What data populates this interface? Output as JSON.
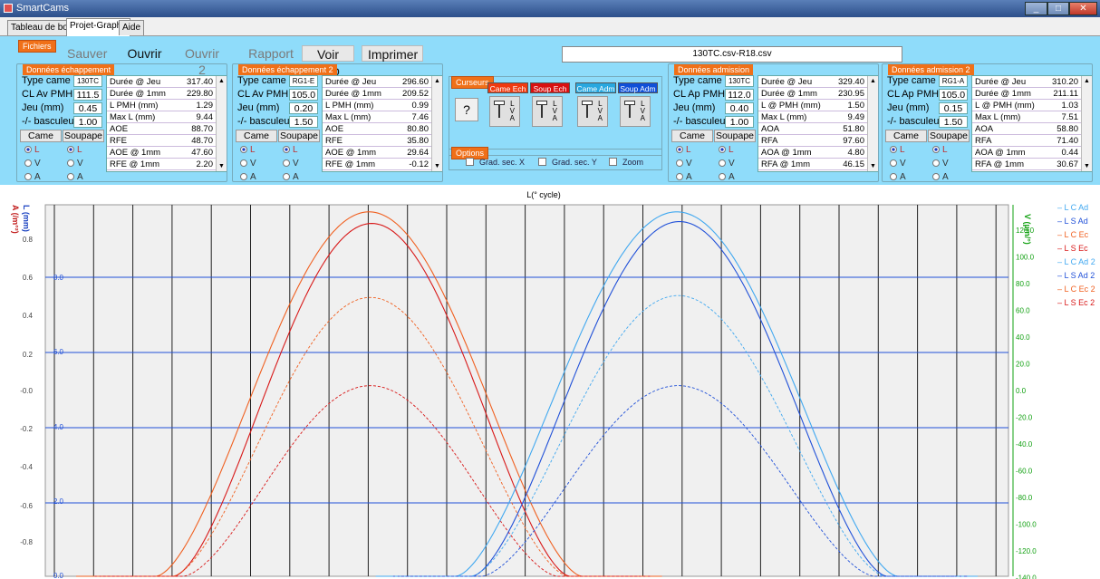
{
  "window": {
    "title": "SmartCams"
  },
  "tabs": [
    {
      "label": "Tableau de bord",
      "active": false
    },
    {
      "label": "Projet-Graphe",
      "active": true
    },
    {
      "label": "Aide",
      "active": false
    }
  ],
  "toolbar": {
    "files_label": "Fichiers",
    "save": "Sauver",
    "open": "Ouvrir",
    "open2": "Ouvrir 2",
    "report": "Rapport",
    "view_report": "Voir Rap",
    "print": "Imprimer"
  },
  "file_name": "130TC.csv-R18.csv",
  "groups": [
    {
      "header": "Données échappement",
      "type_label": "Type came",
      "type_value": "130TC",
      "cl_label": "CL Av PMH",
      "cl_value": "111.5",
      "jeu_label": "Jeu (mm)",
      "jeu_value": "0.45",
      "bas_label": "-/- basculeur",
      "bas_value": "1.00",
      "came": "Came",
      "soupape": "Soupape",
      "rows": [
        [
          "Durée @ Jeu",
          "317.40"
        ],
        [
          "Durée @ 1mm",
          "229.80"
        ],
        [
          "L PMH (mm)",
          "1.29"
        ],
        [
          "Max L (mm)",
          "9.44"
        ],
        [
          "AOE",
          "88.70"
        ],
        [
          "RFE",
          "48.70"
        ],
        [
          "AOE @ 1mm",
          "47.60"
        ],
        [
          "RFE @ 1mm",
          "2.20"
        ]
      ]
    },
    {
      "header": "Données échappement 2",
      "type_label": "Type came",
      "type_value": "RG1-E",
      "cl_label": "CL Av PMH",
      "cl_value": "105.0",
      "jeu_label": "Jeu (mm)",
      "jeu_value": "0.20",
      "bas_label": "-/- basculeur",
      "bas_value": "1.50",
      "came": "Came",
      "soupape": "Soupape",
      "rows": [
        [
          "Durée @ Jeu",
          "296.60"
        ],
        [
          "Durée @ 1mm",
          "209.52"
        ],
        [
          "L PMH (mm)",
          "0.99"
        ],
        [
          "Max L (mm)",
          "7.46"
        ],
        [
          "AOE",
          "80.80"
        ],
        [
          "RFE",
          "35.80"
        ],
        [
          "AOE @ 1mm",
          "29.64"
        ],
        [
          "RFE @ 1mm",
          "-0.12"
        ]
      ]
    },
    {
      "header": "Données admission",
      "type_label": "Type came",
      "type_value": "130TC",
      "cl_label": "CL Ap PMH",
      "cl_value": "112.0",
      "jeu_label": "Jeu (mm)",
      "jeu_value": "0.40",
      "bas_label": "-/- basculeur",
      "bas_value": "1.00",
      "came": "Came",
      "soupape": "Soupape",
      "rows": [
        [
          "Durée @ Jeu",
          "329.40"
        ],
        [
          "Durée @ 1mm",
          "230.95"
        ],
        [
          "L @ PMH (mm)",
          "1.50"
        ],
        [
          "Max L (mm)",
          "9.49"
        ],
        [
          "AOA",
          "51.80"
        ],
        [
          "RFA",
          "97.60"
        ],
        [
          "AOA @ 1mm",
          "4.80"
        ],
        [
          "RFA @ 1mm",
          "46.15"
        ]
      ]
    },
    {
      "header": "Données admission 2",
      "type_label": "Type came",
      "type_value": "RG1-A",
      "cl_label": "CL Ap PMH",
      "cl_value": "105.0",
      "jeu_label": "Jeu (mm)",
      "jeu_value": "0.15",
      "bas_label": "-/- basculeur",
      "bas_value": "1.50",
      "came": "Came",
      "soupape": "Soupape",
      "rows": [
        [
          "Durée @ Jeu",
          "310.20"
        ],
        [
          "Durée @ 1mm",
          "211.11"
        ],
        [
          "L @ PMH (mm)",
          "1.03"
        ],
        [
          "Max L (mm)",
          "7.51"
        ],
        [
          "AOA",
          "58.80"
        ],
        [
          "RFA",
          "71.40"
        ],
        [
          "AOA @ 1mm",
          "0.44"
        ],
        [
          "RFA @ 1mm",
          "30.67"
        ]
      ]
    }
  ],
  "radios": {
    "l": "L",
    "v": "V",
    "a": "A"
  },
  "cursors": {
    "header": "Curseurs",
    "help": "?",
    "buttons": [
      {
        "label": "Came Ech",
        "color": "#f03a10"
      },
      {
        "label": "Soup Ech",
        "color": "#d81010"
      },
      {
        "label": "Came Adm",
        "color": "#28a8e0"
      },
      {
        "label": "Soup Adm",
        "color": "#1050d8"
      }
    ],
    "lva": "L\nV\nA"
  },
  "options": {
    "header": "Options",
    "grad_x": "Grad. sec. X",
    "grad_y": "Grad. sec. Y",
    "zoom": "Zoom"
  },
  "chart_data": {
    "type": "line",
    "title": "L(° cycle)",
    "left_axis_a": {
      "label": "A (/m°²)",
      "ticks": [
        "0.8",
        "0.6",
        "0.4",
        "0.2",
        "-0.0",
        "-0.2",
        "-0.4",
        "-0.6",
        "-0.8"
      ],
      "color": "#c01818"
    },
    "left_axis_l": {
      "label": "L (mm)",
      "ticks": [
        "8.0",
        "6.0",
        "4.0",
        "2.0",
        "0.0"
      ],
      "color": "#1840c0"
    },
    "right_axis_v": {
      "label": "V (µm/°)",
      "ticks": [
        "120.0",
        "100.0",
        "80.0",
        "60.0",
        "40.0",
        "20.0",
        "0.0",
        "-20.0",
        "-40.0",
        "-60.0",
        "-80.0",
        "-100.0",
        "-120.0",
        "-140.0"
      ],
      "color": "#10a010"
    },
    "legend": [
      {
        "name": "L C Ad",
        "color": "#40a8f0"
      },
      {
        "name": "L S Ad",
        "color": "#2050d8"
      },
      {
        "name": "L C Ec",
        "color": "#f06020"
      },
      {
        "name": "L S Ec",
        "color": "#d81818"
      },
      {
        "name": "L C Ad 2",
        "color": "#40a8f0"
      },
      {
        "name": "L S Ad 2",
        "color": "#2050d8"
      },
      {
        "name": "L C Ec 2",
        "color": "#f06020"
      },
      {
        "name": "L S Ec 2",
        "color": "#d81818"
      }
    ],
    "x_range": [
      0,
      720
    ],
    "series": [
      {
        "name": "L C Ec",
        "center": 242,
        "half": 159,
        "peak": 9.75,
        "dashed": false
      },
      {
        "name": "L S Ec",
        "center": 244,
        "half": 148,
        "peak": 9.44,
        "dashed": false
      },
      {
        "name": "L C Ec 2",
        "center": 243,
        "half": 148,
        "peak": 7.46,
        "dashed": true
      },
      {
        "name": "L S Ec 2",
        "center": 243,
        "half": 140,
        "peak": 5.1,
        "dashed": true
      },
      {
        "name": "L C Ad",
        "center": 472,
        "half": 165,
        "peak": 9.75,
        "dashed": false
      },
      {
        "name": "L S Ad",
        "center": 474,
        "half": 155,
        "peak": 9.49,
        "dashed": false
      },
      {
        "name": "L C Ad 2",
        "center": 473,
        "half": 155,
        "peak": 7.51,
        "dashed": true
      },
      {
        "name": "L S Ad 2",
        "center": 473,
        "half": 147,
        "peak": 5.1,
        "dashed": true
      }
    ]
  }
}
